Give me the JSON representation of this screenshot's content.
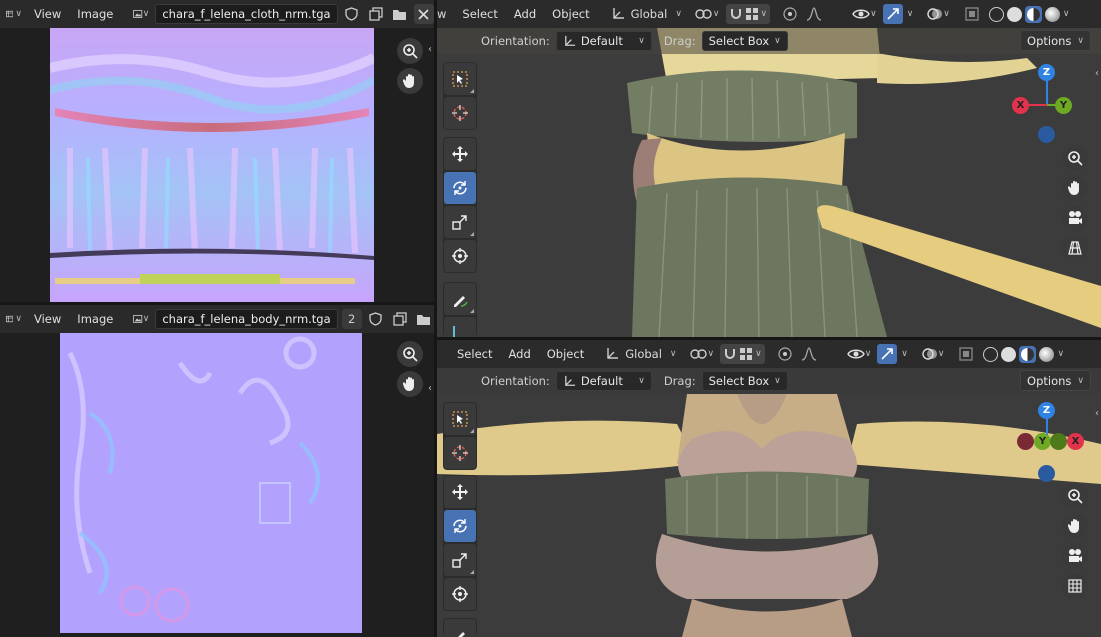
{
  "top_image_editor": {
    "menu": [
      "View",
      "Image"
    ],
    "image_name": "chara_f_lelena_cloth_nrm.tga"
  },
  "bottom_image_editor": {
    "menu": [
      "View",
      "Image"
    ],
    "image_name": "chara_f_lelena_body_nrm.tga",
    "user_count": "2"
  },
  "top_viewport": {
    "menu_partial": "w",
    "menu": [
      "Select",
      "Add",
      "Object"
    ],
    "transform_orientation": "Global",
    "orientation_label": "Orientation:",
    "orientation_value": "Default",
    "drag_label": "Drag:",
    "drag_value": "Select Box",
    "options_label": "Options",
    "gizmo": {
      "z": "Z",
      "y": "Y",
      "x": "X"
    }
  },
  "bottom_viewport": {
    "menu": [
      "Select",
      "Add",
      "Object"
    ],
    "transform_orientation": "Global",
    "orientation_label": "Orientation:",
    "orientation_value": "Default",
    "drag_label": "Drag:",
    "drag_value": "Select Box",
    "options_label": "Options",
    "gizmo": {
      "z": "Z",
      "y": "Y",
      "x": "X"
    }
  },
  "colors": {
    "accent_active": "#4772b3",
    "axis_x": "#e2334d",
    "axis_y": "#6ea923",
    "axis_z": "#2f83e4",
    "normal_map_base": "#b49eff"
  }
}
